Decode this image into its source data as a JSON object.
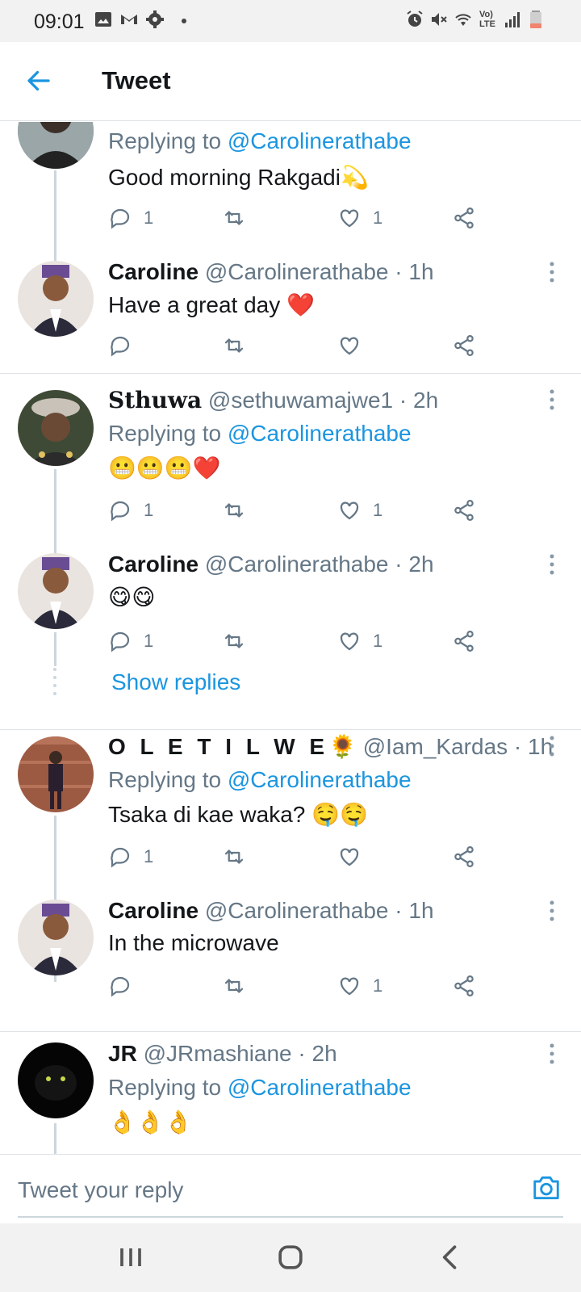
{
  "status_bar": {
    "time": "09:01",
    "left_icons": [
      "gallery-icon",
      "gmail-icon",
      "settings-icon"
    ],
    "right_icons": [
      "alarm-icon",
      "mute-icon",
      "wifi-icon",
      "volte-icon",
      "signal-icon",
      "battery-icon"
    ],
    "volte_label": "Vo) LTE"
  },
  "header": {
    "back_icon": "arrow-left-icon",
    "title": "Tweet"
  },
  "tweets": [
    {
      "reply_label": "Replying to",
      "reply_mention": "@Carolinerathabe",
      "text": "Good morning Rakgadi",
      "emoji": "💫",
      "reply_count": "1",
      "retweet_count": "",
      "like_count": "1"
    },
    {
      "name": "Caroline",
      "handle": "@Carolinerathabe",
      "time": "· 1h",
      "text": "Have a great day",
      "emoji": "❤️",
      "reply_count": "",
      "retweet_count": "",
      "like_count": ""
    },
    {
      "name": "Sthuwa",
      "handle": "@sethuwamajwe1",
      "time": "· 2h",
      "reply_label": "Replying to",
      "reply_mention": "@Carolinerathabe",
      "text": "",
      "emoji": "😬😬😬❤️",
      "reply_count": "1",
      "retweet_count": "",
      "like_count": "1"
    },
    {
      "name": "Caroline",
      "handle": "@Carolinerathabe",
      "time": "· 2h",
      "text": "",
      "emoji": "😋😋",
      "reply_count": "1",
      "retweet_count": "",
      "like_count": "1"
    },
    {
      "name": "O L E T I L W E",
      "name_emoji": "🌻",
      "handle": "@Iam_Kardas",
      "time": "· 1h",
      "reply_label": "Replying to",
      "reply_mention": "@Carolinerathabe",
      "text": "Tsaka di kae waka?",
      "emoji": "🤤🤤",
      "reply_count": "1",
      "retweet_count": "",
      "like_count": ""
    },
    {
      "name": "Caroline",
      "handle": "@Carolinerathabe",
      "time": "· 1h",
      "text": "In the microwave",
      "reply_count": "",
      "retweet_count": "",
      "like_count": "1"
    },
    {
      "name": "JR",
      "handle": "@JRmashiane",
      "time": "· 2h",
      "reply_label": "Replying to",
      "reply_mention": "@Carolinerathabe",
      "emoji": "👌👌👌"
    }
  ],
  "show_replies": "Show replies",
  "compose": {
    "placeholder": "Tweet your reply",
    "camera_icon": "camera-icon"
  },
  "nav_bar": {
    "icons": [
      "recent-apps-icon",
      "home-icon",
      "back-icon"
    ]
  },
  "colors": {
    "accent": "#1b95e0",
    "secondary_text": "#657786",
    "primary_text": "#14171a",
    "heart": "#e0245e"
  }
}
